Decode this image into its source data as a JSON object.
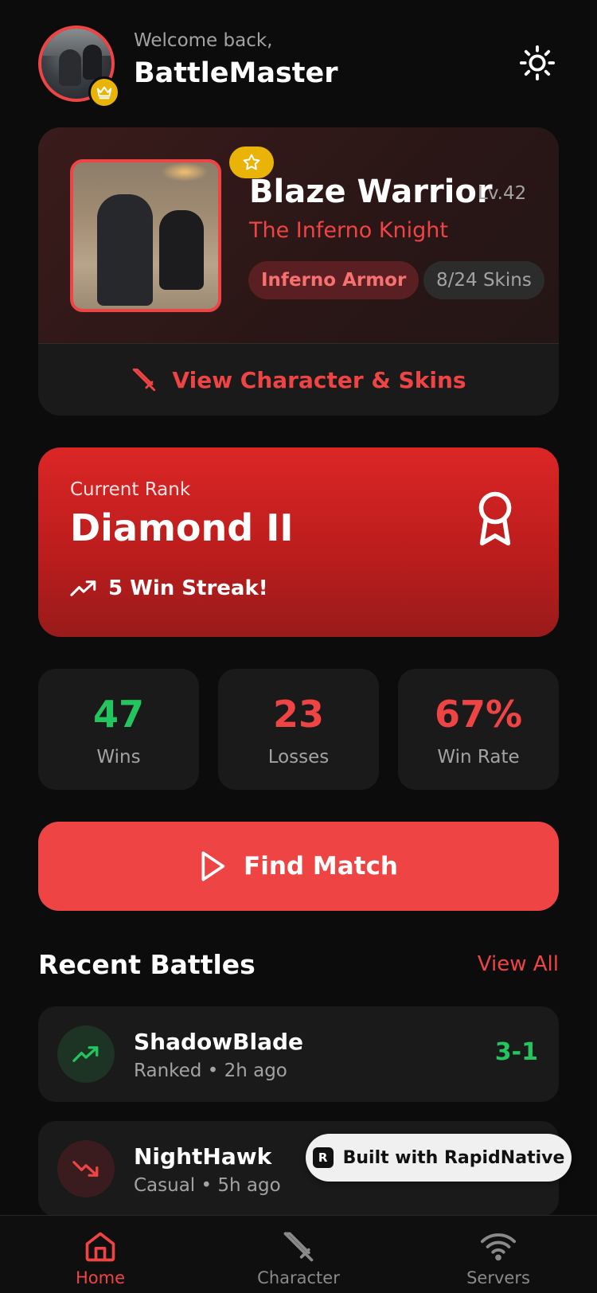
{
  "header": {
    "welcome": "Welcome back,",
    "username": "BattleMaster",
    "avatar_badge_icon": "crown-icon",
    "theme_icon": "sun-icon"
  },
  "character": {
    "name": "Blaze Warrior",
    "level": "Lv.42",
    "title": "The Inferno Knight",
    "armor_tag": "Inferno Armor",
    "skins_tag": "8/24 Skins",
    "badge_icon": "star-icon",
    "view_label": "View Character & Skins",
    "view_icon": "sword-icon"
  },
  "rank": {
    "label": "Current Rank",
    "value": "Diamond II",
    "streak": "5 Win Streak!",
    "icon": "award-ribbon-icon"
  },
  "stats": [
    {
      "value": "47",
      "label": "Wins",
      "color": "#22c55e"
    },
    {
      "value": "23",
      "label": "Losses",
      "color": "#ef4444"
    },
    {
      "value": "67%",
      "label": "Win Rate",
      "color": "#ef4444"
    }
  ],
  "find_match": {
    "label": "Find Match",
    "icon": "play-icon"
  },
  "recent": {
    "title": "Recent Battles",
    "view_all": "View All",
    "battles": [
      {
        "opponent": "ShadowBlade",
        "meta": "Ranked • 2h ago",
        "score": "3-1",
        "result": "win",
        "icon": "trending-up-icon"
      },
      {
        "opponent": "NightHawk",
        "meta": "Casual • 5h ago",
        "score": "",
        "result": "loss",
        "icon": "trending-down-icon"
      }
    ]
  },
  "promo": {
    "label": "Built with RapidNative",
    "logo": "R"
  },
  "nav": {
    "items": [
      {
        "label": "Home",
        "icon": "home-icon",
        "active": true
      },
      {
        "label": "Character",
        "icon": "sword-icon",
        "active": false
      },
      {
        "label": "Servers",
        "icon": "wifi-icon",
        "active": false
      }
    ]
  },
  "colors": {
    "accent": "#ef4444",
    "win": "#22c55e",
    "gold": "#eab308",
    "background": "#0c0c0c",
    "card": "#1a1a1a"
  }
}
